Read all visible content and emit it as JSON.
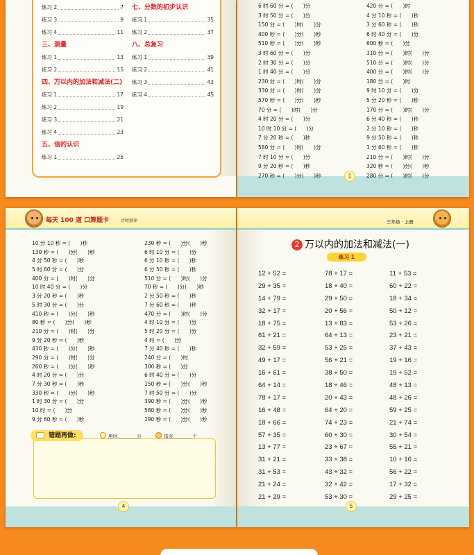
{
  "toc": {
    "left": [
      {
        "type": "item",
        "label": "练习 2",
        "page": "7"
      },
      {
        "type": "item",
        "label": "练习 3",
        "page": "9"
      },
      {
        "type": "item",
        "label": "练习 4",
        "page": "11"
      },
      {
        "type": "section",
        "label": "三、测量"
      },
      {
        "type": "item",
        "label": "练习 1",
        "page": "13"
      },
      {
        "type": "item",
        "label": "练习 2",
        "page": "15"
      },
      {
        "type": "section",
        "label": "四、万以内的加法和减法(二)"
      },
      {
        "type": "item",
        "label": "练习 1",
        "page": "17"
      },
      {
        "type": "item",
        "label": "练习 2",
        "page": "19"
      },
      {
        "type": "item",
        "label": "练习 3",
        "page": "21"
      },
      {
        "type": "item",
        "label": "练习 4",
        "page": "23"
      },
      {
        "type": "section",
        "label": "五、倍的认识"
      },
      {
        "type": "item",
        "label": "练习 1",
        "page": "25"
      }
    ],
    "right": [
      {
        "type": "section",
        "label": "七、分数的初步认识"
      },
      {
        "type": "item",
        "label": "练习 1",
        "page": "35"
      },
      {
        "type": "item",
        "label": "练习 2",
        "page": "37"
      },
      {
        "type": "section",
        "label": "八、总复习"
      },
      {
        "type": "item",
        "label": "练习 1",
        "page": "39"
      },
      {
        "type": "item",
        "label": "练习 2",
        "page": "41"
      },
      {
        "type": "item",
        "label": "练习 3",
        "page": "43"
      },
      {
        "type": "item",
        "label": "练习 4",
        "page": "45"
      }
    ]
  },
  "page1": {
    "number": "1",
    "left": [
      "6 时 60 分 = (      )分",
      "3 时 50 分 = (      )分",
      "150 分 = (      )时(      )分",
      "400 秒 = (      )分(      )秒",
      "510 秒 = (      )分(      )秒",
      "3 时 60 分 = (      )分",
      "2 时 30 分 = (      )分",
      "1 时 40 分 = (      )分",
      "230 分 = (      )时(      )分",
      "330 分 = (      )时(      )分",
      "570 秒 = (      )分(      )秒",
      "70 分 = (      )时(      )分",
      "4 时 20 分 = (      )分",
      "10 时 10 分 = (      )分",
      "7 分 20 秒 = (      )秒",
      "580 分 = (      )时(      )分",
      "7 时 10 分 = (      )分",
      "9 分 20 秒 = (      )秒",
      "270 秒 = (      )分(      )秒"
    ],
    "right": [
      "420 分 = (      )时",
      "4 分 10 秒 = (      )秒",
      "3 分 60 秒 = (      )秒",
      "6 时 40 分 = (      )分",
      "600 秒 = (      )分",
      "310 分 = (      )时(      )分",
      "510 分 = (      )时(      )分",
      "400 分 = (      )时(      )分",
      "180 分 = (      )时",
      "9 时 10 分 = (      )分",
      "5 分 20 秒 = (      )秒",
      "170 分 = (      )时(      )分",
      "6 分 40 秒 = (      )秒",
      "2 分 10 秒 = (      )秒",
      "9 分 50 秒 = (      )秒",
      "1 分 60 秒 = (      )秒",
      "210 分 = (      )时(      )分",
      "320 秒 = (      )分(      )秒",
      "280 分 = (      )时(      )分"
    ]
  },
  "page4": {
    "header_brand": "每天 100 道 口算题卡",
    "header_sub": "计时测评",
    "number": "4",
    "left": [
      "10 分 10 秒 = (      )秒",
      "130 秒 = (      )分(      )秒",
      "4 分 50 秒 = (      )秒",
      "5 时 60 分 = (      )分",
      "400 分 = (      )时(      )分",
      "10 时 40 分 = (      )分",
      "3 分 20 秒 = (      )秒",
      "5 时 30 分 = (      )分",
      "410 秒 = (      )分(      )秒",
      "80 秒 = (      )分(      )秒",
      "210 分 = (      )时(      )分",
      "9 分 20 秒 = (      )秒",
      "430 秒 = (      )分(      )秒",
      "290 分 = (      )时(      )分",
      "260 秒 = (      )分(      )秒",
      "4 时 20 分 = (      )分",
      "7 分 30 秒 = (      )秒",
      "330 秒 = (      )分(      )秒",
      "1 时 30 分 = (      )分",
      "10 时 = (      )分",
      "9 分 60 秒 = (      )秒"
    ],
    "right": [
      "230 秒 = (      )分(      )秒",
      "6 时 10 分 = (      )分",
      "6 分 10 秒 = (      )秒",
      "6 分 50 秒 = (      )秒",
      "510 分 = (      )时(      )分",
      "70 秒 = (      )分(      )秒",
      "2 分 50 秒 = (      )秒",
      "7 分 60 秒 = (      )秒",
      "470 分 = (      )时(      )分",
      "4 时 10 分 = (      )分",
      "5 时 20 分 = (      )分",
      "4 时 = (      )分",
      "7 分 40 秒 = (      )秒",
      "240 分 = (      )时",
      "300 秒 = (      )分",
      "6 时 40 分 = (      )分",
      "150 秒 = (      )分(      )秒",
      "7 时 50 分 = (      )分",
      "390 秒 = (      )分(      )秒",
      "580 秒 = (      )分(      )秒",
      "190 秒 = (      )分(      )秒"
    ],
    "mistakes_title": "错题再做:",
    "time_label": "用时:________分",
    "error_label": "错误:________个"
  },
  "page5": {
    "header_right": "三年级 · 上册",
    "section_number": "2",
    "section_title": "万以内的加法和减法(一)",
    "exercise_label": "练习 1",
    "number": "5",
    "col1": [
      "12 + 52 =",
      "29 + 35 =",
      "14 + 79 =",
      "32 + 17 =",
      "18 + 75 =",
      "61 + 21 =",
      "32 + 59 =",
      "49 + 17 =",
      "16 + 61 =",
      "64 + 14 =",
      "78 + 17 =",
      "16 + 48 =",
      "18 + 66 =",
      "57 + 35 =",
      "13 + 77 =",
      "31 + 21 =",
      "31 + 53 =",
      "21 + 24 =",
      "21 + 29 ="
    ],
    "col2": [
      "78 + 17 =",
      "18 + 40 =",
      "29 + 50 =",
      "20 + 56 =",
      "13 + 83 =",
      "64 + 13 =",
      "53 + 25 =",
      "56 + 21 =",
      "38 + 50 =",
      "18 + 46 =",
      "20 + 43 =",
      "64 + 20 =",
      "74 + 23 =",
      "60 + 30 =",
      "23 + 67 =",
      "33 + 38 =",
      "43 + 32 =",
      "32 + 42 =",
      "53 + 30 ="
    ],
    "col3": [
      "11 + 53 =",
      "60 + 22 =",
      "18 + 34 =",
      "50 + 12 =",
      "53 + 26 =",
      "23 + 21 =",
      "37 + 43 =",
      "19 + 16 =",
      "19 + 52 =",
      "48 + 13 =",
      "48 + 26 =",
      "59 + 25 =",
      "21 + 74 =",
      "30 + 54 =",
      "55 + 21 =",
      "10 + 16 =",
      "56 + 22 =",
      "17 + 32 =",
      "29 + 25 ="
    ]
  }
}
